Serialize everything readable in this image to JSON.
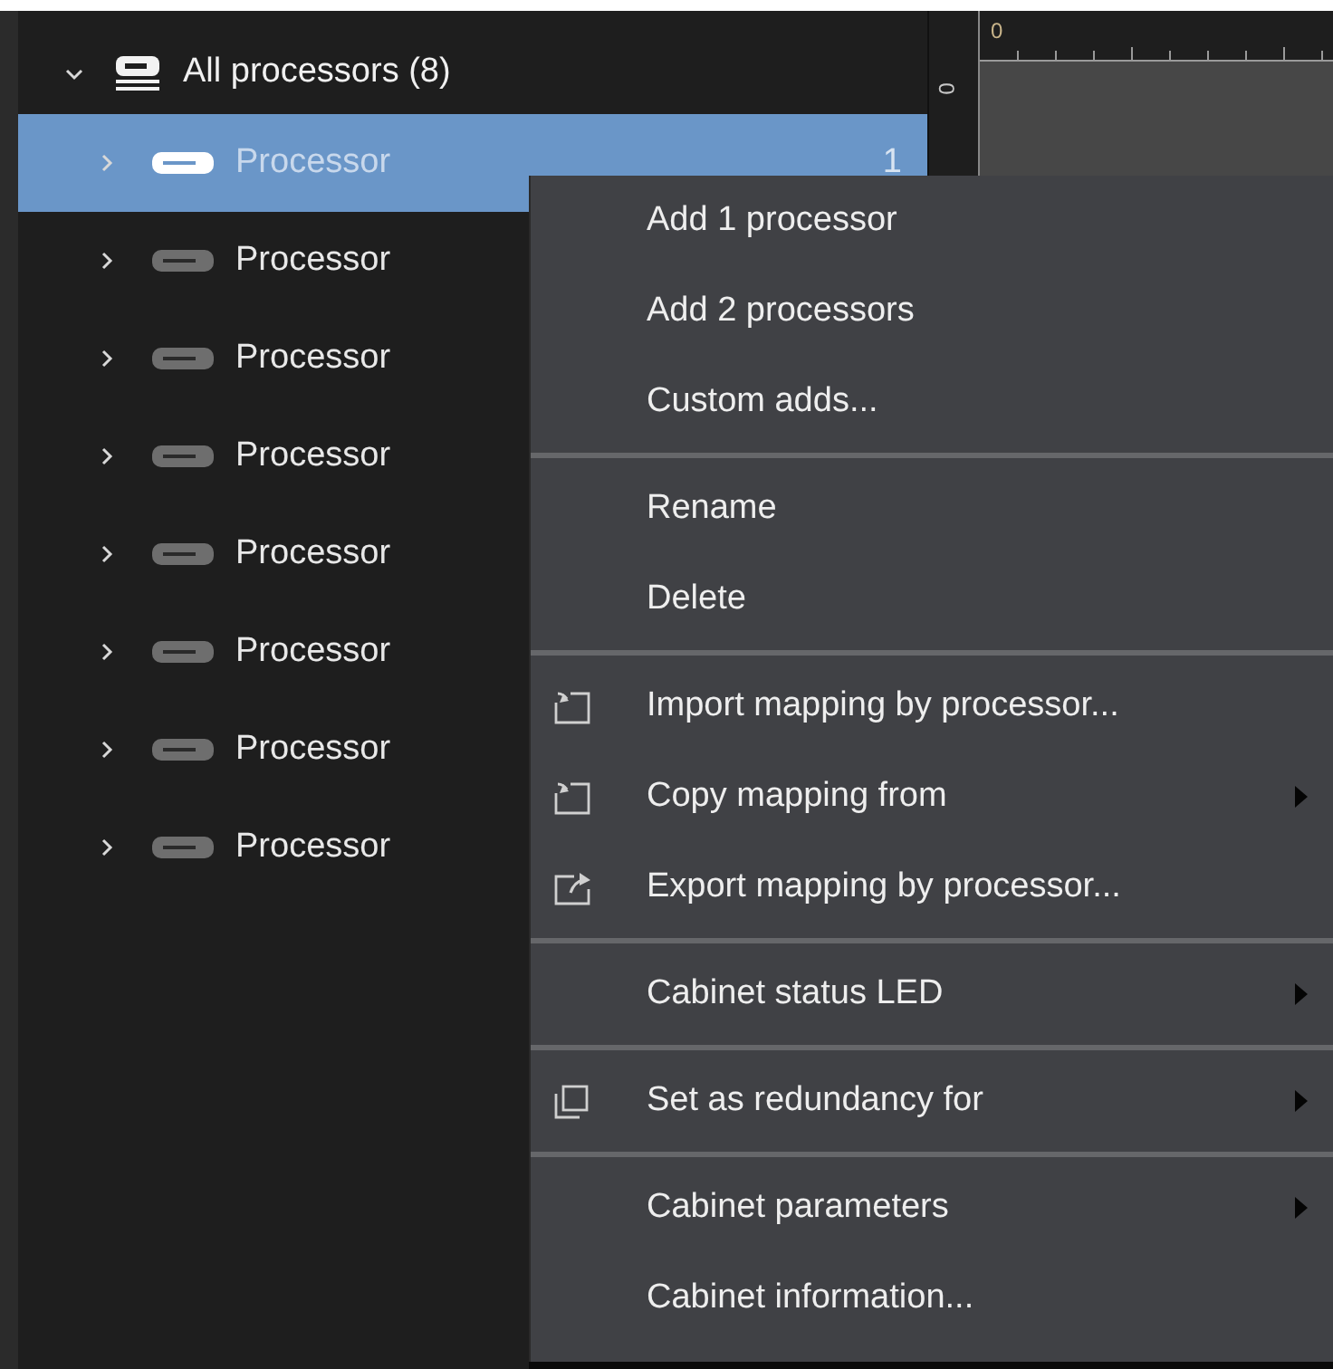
{
  "tree": {
    "header": {
      "label": "All processors (8)",
      "expanded": true
    },
    "items": [
      {
        "label": "Processor",
        "selected": true,
        "expanded": false,
        "count": "1"
      },
      {
        "label": "Processor",
        "selected": false,
        "expanded": false
      },
      {
        "label": "Processor",
        "selected": false,
        "expanded": false
      },
      {
        "label": "Processor",
        "selected": false,
        "expanded": false
      },
      {
        "label": "Processor",
        "selected": false,
        "expanded": false
      },
      {
        "label": "Processor",
        "selected": false,
        "expanded": false
      },
      {
        "label": "Processor",
        "selected": false,
        "expanded": false
      },
      {
        "label": "Processor",
        "selected": false,
        "expanded": false
      }
    ]
  },
  "canvas": {
    "top_ruler_label": "0",
    "left_ruler_label": "0"
  },
  "context_menu": [
    {
      "kind": "command",
      "label": "Add 1 processor",
      "submenu": false
    },
    {
      "kind": "command",
      "label": "Add 2 processors",
      "submenu": false
    },
    {
      "kind": "command",
      "label": "Custom adds...",
      "submenu": false
    },
    {
      "kind": "separator"
    },
    {
      "kind": "command",
      "label": "Rename",
      "submenu": false
    },
    {
      "kind": "command",
      "label": "Delete",
      "submenu": false
    },
    {
      "kind": "separator"
    },
    {
      "kind": "import",
      "label": "Import mapping by processor...",
      "submenu": false
    },
    {
      "kind": "import",
      "label": "Copy mapping from",
      "submenu": true
    },
    {
      "kind": "export",
      "label": "Export mapping by processor...",
      "submenu": false
    },
    {
      "kind": "separator"
    },
    {
      "kind": "command",
      "label": "Cabinet status LED",
      "submenu": true
    },
    {
      "kind": "separator"
    },
    {
      "kind": "duplicate",
      "label": "Set as redundancy for",
      "submenu": true
    },
    {
      "kind": "separator"
    },
    {
      "kind": "command",
      "label": "Cabinet parameters",
      "submenu": true
    },
    {
      "kind": "command",
      "label": "Cabinet information...",
      "submenu": false
    }
  ]
}
